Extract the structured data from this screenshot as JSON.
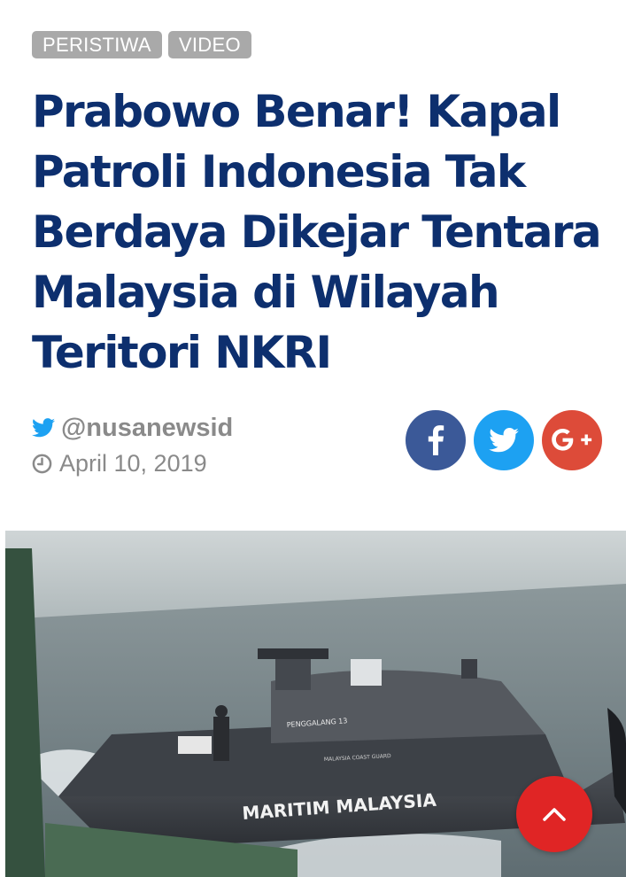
{
  "tags": [
    "PERISTIWA",
    "VIDEO"
  ],
  "article": {
    "title_lines": [
      "Prabowo Benar! Kapal",
      "Patroli Indonesia Tak",
      "Berdaya Dikejar Tentara",
      "Malaysia di Wilayah",
      "Teritori NKRI"
    ],
    "author": "@nusanewsid",
    "date": "April 10, 2019"
  },
  "share": {
    "facebook_icon": "facebook-icon",
    "twitter_icon": "twitter-icon",
    "google_plus_icon": "google-plus-icon",
    "colors": {
      "facebook": "#3b5998",
      "twitter": "#1da1f2",
      "google_plus": "#dd4b39"
    }
  },
  "photo": {
    "hull_text": "MARITIM MALAYSIA",
    "side_text": "PENGGALANG 13",
    "small_text": "MALAYSIA COAST GUARD"
  },
  "colors": {
    "title": "#0d2f6e",
    "tag_bg": "#a9a9a9",
    "meta": "#8a8a8a",
    "scroll_top": "#e02525"
  },
  "scroll_top_icon": "chevron-up-icon"
}
